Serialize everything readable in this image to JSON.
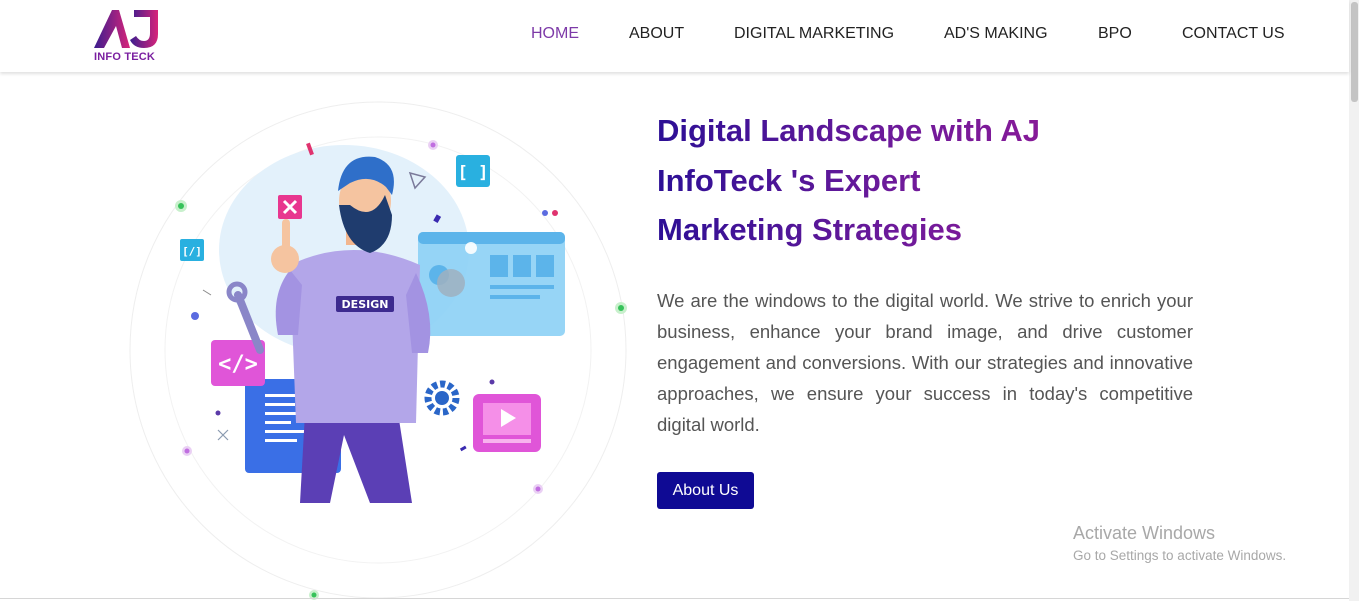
{
  "brand": {
    "logo_letters": "AJ",
    "logo_sub": "INFO TECK"
  },
  "nav": {
    "items": [
      {
        "label": "HOME",
        "active": true
      },
      {
        "label": "ABOUT",
        "active": false
      },
      {
        "label": "DIGITAL MARKETING",
        "active": false
      },
      {
        "label": "AD'S MAKING",
        "active": false
      },
      {
        "label": "BPO",
        "active": false
      },
      {
        "label": "CONTACT US",
        "active": false
      }
    ]
  },
  "hero": {
    "title_lines": [
      "Digital Landscape with AJ",
      "InfoTeck 's Expert",
      "Marketing Strategies"
    ],
    "description": "We are the windows to the digital world. We strive to enrich your business, enhance your brand image, and drive customer engagement and conversions. With our strategies and innovative approaches, we ensure your success in today's competitive digital world.",
    "button_label": "About Us",
    "illustration": {
      "badge_text": "DESIGN",
      "code_tag": "</>",
      "bracket_tag": "[ ]",
      "slash_tag": "[/]"
    }
  },
  "system": {
    "activate_title": "Activate Windows",
    "activate_sub": "Go to Settings to activate Windows."
  },
  "colors": {
    "nav_active": "#7d3aa8",
    "button_bg": "#0f0a94",
    "title_gradient_start": "#2c0f95",
    "title_gradient_end": "#8d1a98"
  }
}
